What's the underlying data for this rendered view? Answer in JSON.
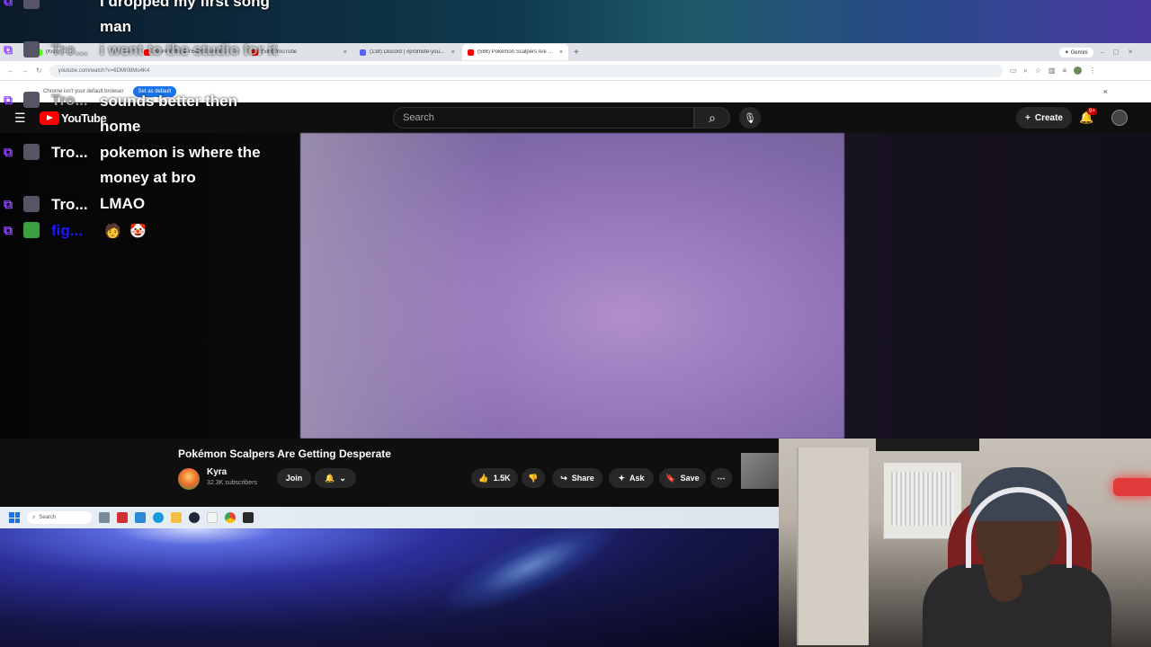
{
  "chat": {
    "messages": [
      {
        "user": "",
        "text": "I dropped my first song man"
      },
      {
        "user": "Tro...",
        "text": "i went to the studio for it"
      },
      {
        "user": "Tro...",
        "text": "sounds better then home"
      },
      {
        "user": "Tro...",
        "text": "pokemon is where the money at bro"
      },
      {
        "user": "Tro...",
        "text": "LMAO"
      },
      {
        "user": "fig...",
        "text": ""
      }
    ]
  },
  "browser": {
    "tabs": [
      {
        "title": "(Kick) ..."
      },
      {
        "title": "HAPPY NEW YEARS STRE..."
      },
      {
        "title": "(586) YouTube"
      },
      {
        "title": "(138) Discord | #promote-you..."
      },
      {
        "title": "(586) Pokémon Scalpers Are Ge..."
      }
    ],
    "new_tab": "+",
    "gemini_label": "Gemini",
    "url": "youtube.com/watch?v=6DMI08Mo4K4",
    "infobar_text": "Chrome isn't your default browser",
    "set_default_label": "Set as default"
  },
  "youtube": {
    "logo_text": "YouTube",
    "search_placeholder": "Search",
    "create_label": "Create",
    "notif_count": "9+",
    "video_title": "Pokémon Scalpers Are Getting Desperate",
    "channel_name": "Kyra",
    "subscribers": "32.3K subscribers",
    "join_label": "Join",
    "likes": "1.5K",
    "share_label": "Share",
    "ask_label": "Ask",
    "save_label": "Save"
  },
  "taskbar": {
    "search_label": "Search"
  },
  "colors": {
    "yt_red": "#ff0000",
    "twitch_purple": "#9146ff",
    "chrome_blue": "#1a73e8"
  }
}
